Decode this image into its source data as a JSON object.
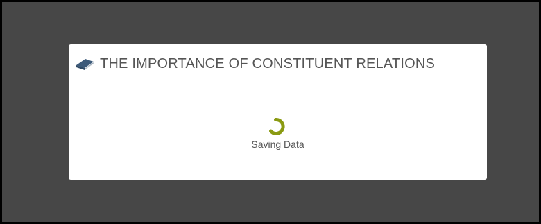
{
  "modal": {
    "title": "THE IMPORTANCE OF CONSTITUENT RELATIONS",
    "icon": "book-icon",
    "status_text": "Saving Data"
  },
  "colors": {
    "overlay": "#474747",
    "modal_background": "#ffffff",
    "spinner": "#8a9a12",
    "icon": "#3c5a7a",
    "text": "#555555"
  }
}
